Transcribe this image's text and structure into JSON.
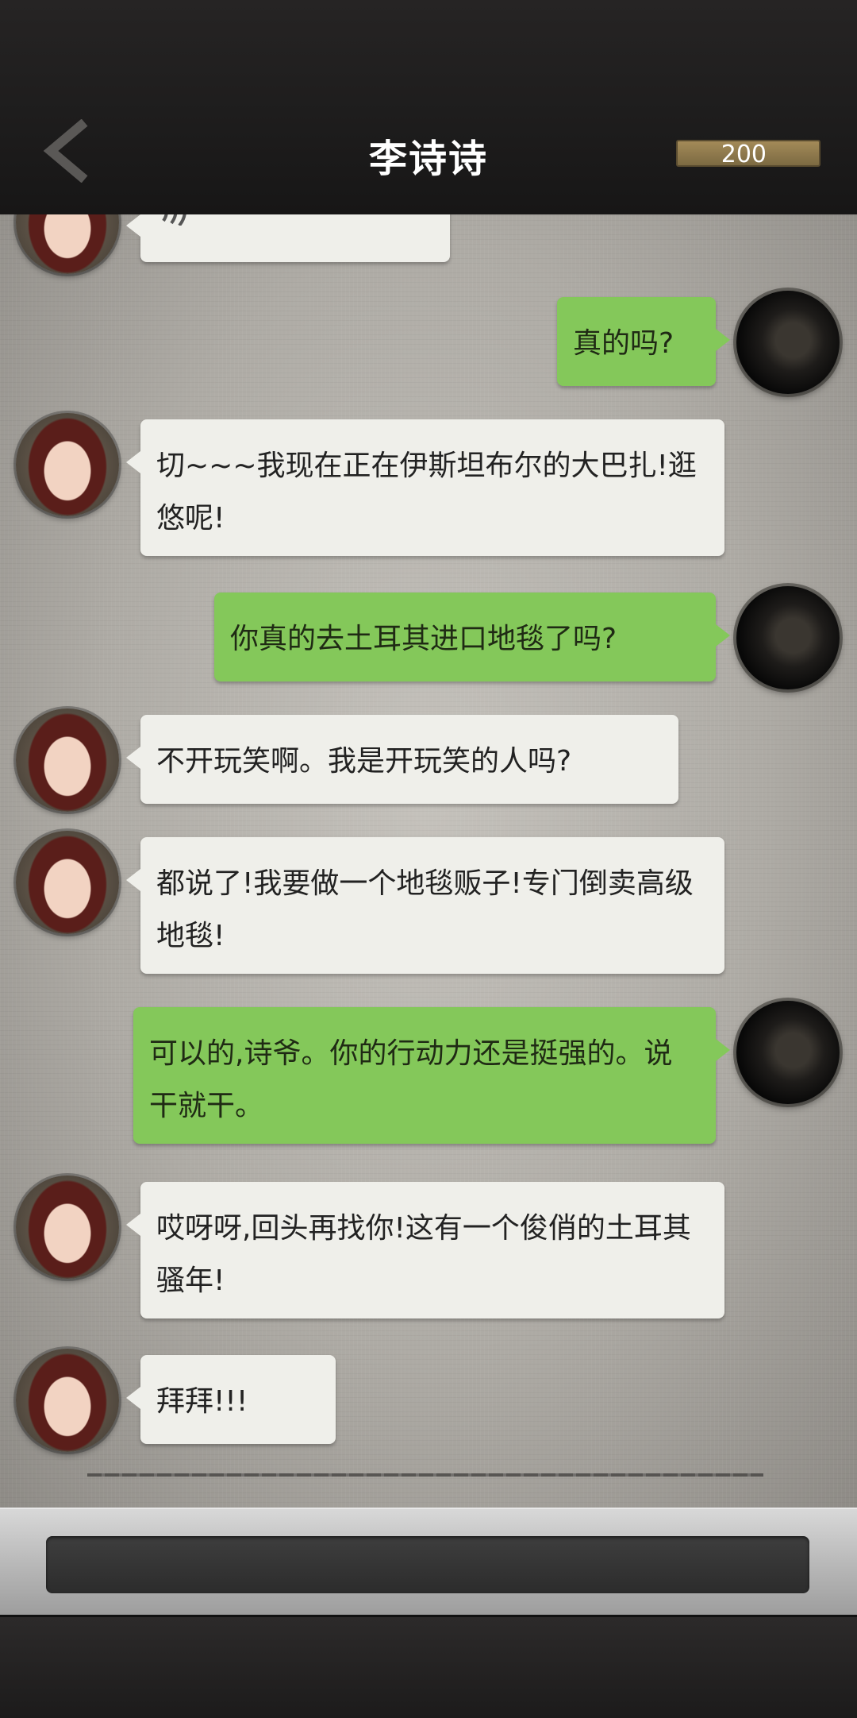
{
  "header": {
    "title": "李诗诗",
    "coins": "200",
    "back_icon": "chevron-left-icon"
  },
  "messages": [
    {
      "side": "left",
      "text": "",
      "icon": "voice-wave-icon"
    },
    {
      "side": "right",
      "text": "真的吗?"
    },
    {
      "side": "left",
      "text": "切~~~我现在正在伊斯坦布尔的大巴扎!逛悠呢!"
    },
    {
      "side": "right",
      "text": "你真的去土耳其进口地毯了吗?"
    },
    {
      "side": "left",
      "text": "不开玩笑啊。我是开玩笑的人吗?"
    },
    {
      "side": "left",
      "text": "都说了!我要做一个地毯贩子!专门倒卖高级地毯!"
    },
    {
      "side": "right",
      "text": "可以的,诗爷。你的行动力还是挺强的。说干就干。"
    },
    {
      "side": "left",
      "text": "哎呀呀,回头再找你!这有一个俊俏的土耳其骚年!"
    },
    {
      "side": "left",
      "text": "拜拜!!!"
    }
  ],
  "input": {
    "value": ""
  },
  "colors": {
    "outgoing_bubble": "#84c85a",
    "incoming_bubble": "#efefea",
    "coin_badge": "#a38a58"
  }
}
